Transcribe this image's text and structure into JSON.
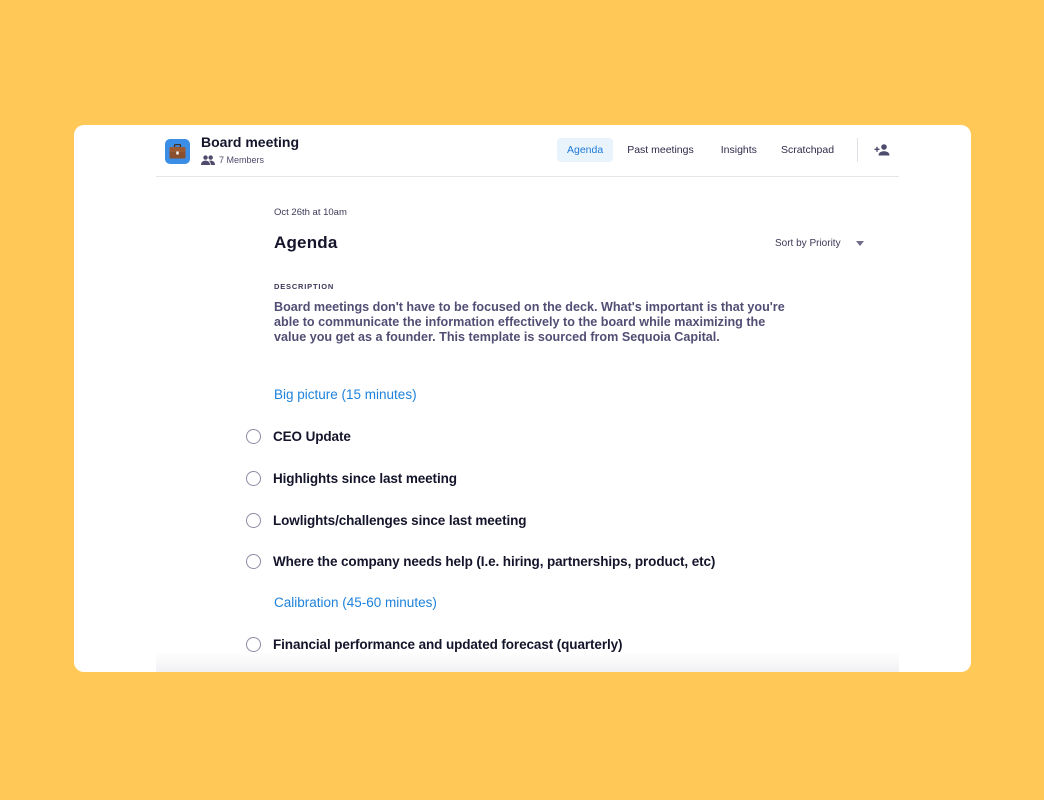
{
  "header": {
    "title": "Board meeting",
    "members_label": "7 Members",
    "app_icon": "briefcase-icon",
    "members_icon": "people-icon",
    "add_member_icon": "person-add-icon"
  },
  "tabs": [
    {
      "label": "Agenda",
      "active": true
    },
    {
      "label": "Past meetings",
      "active": false
    },
    {
      "label": "Insights",
      "active": false
    },
    {
      "label": "Scratchpad",
      "active": false
    }
  ],
  "main": {
    "date": "Oct 26th at 10am",
    "title": "Agenda",
    "sort": {
      "selected": "Sort by Priority",
      "icon": "caret-down-icon"
    },
    "description_label": "DESCRIPTION",
    "description": "Board meetings don't have to be focused on the deck. What's important is that you're able to communicate the information effectively to the board while maximizing the value you get as a founder. This template is sourced from Sequoia Capital."
  },
  "agenda": {
    "sections": [
      {
        "title": "Big picture (15 minutes)"
      },
      {
        "title": "Calibration (45-60 minutes)"
      }
    ],
    "items": [
      {
        "label": "CEO Update",
        "checked": false
      },
      {
        "label": "Highlights since last meeting",
        "checked": false
      },
      {
        "label": "Lowlights/challenges since last meeting",
        "checked": false
      },
      {
        "label": "Where the company needs help (I.e. hiring, partnerships, product, etc)",
        "checked": false
      },
      {
        "label": "Financial performance and updated forecast (quarterly)",
        "checked": false
      }
    ]
  },
  "colors": {
    "background": "#FFC857",
    "accent": "#1E82DB",
    "active_tab_bg": "#E8F3FC",
    "app_icon_bg": "#3B8EE6"
  }
}
